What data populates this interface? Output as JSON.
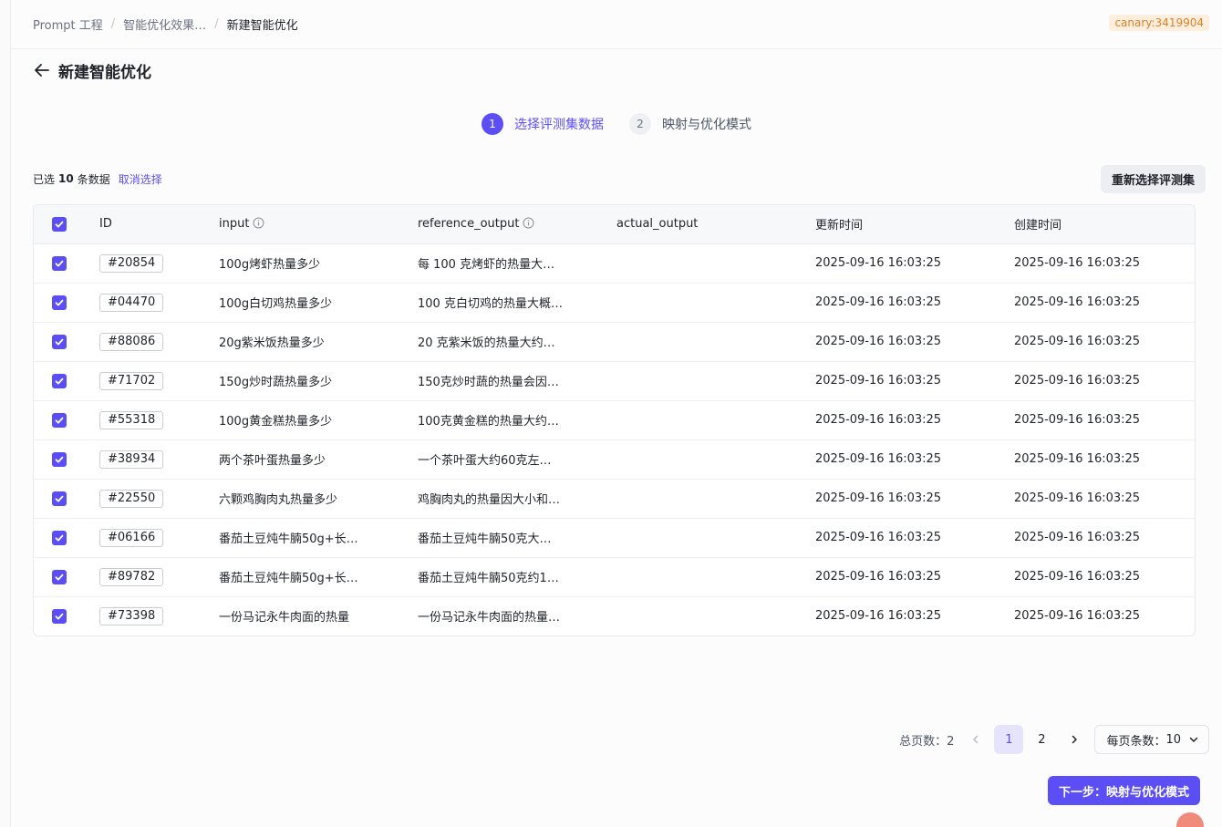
{
  "breadcrumb": {
    "items": [
      "Prompt 工程",
      "智能优化效果…",
      "新建智能优化"
    ],
    "separator": "/"
  },
  "env_badge": "canary:3419904",
  "page": {
    "title": "新建智能优化"
  },
  "steps": [
    {
      "number": "1",
      "label": "选择评测集数据",
      "state": "active"
    },
    {
      "number": "2",
      "label": "映射与优化模式",
      "state": "pending"
    }
  ],
  "selection": {
    "prefix": "已选",
    "count": "10",
    "suffix": "条数据",
    "cancel_label": "取消选择",
    "reselect_label": "重新选择评测集"
  },
  "table": {
    "columns": [
      "ID",
      "input",
      "reference_output",
      "actual_output",
      "更新时间",
      "创建时间"
    ],
    "rows": [
      {
        "id": "#20854",
        "input": "100g烤虾热量多少",
        "reference_output": "每 100 克烤虾的热量大…",
        "actual_output": "",
        "updated": "2025-09-16 16:03:25",
        "created": "2025-09-16 16:03:25"
      },
      {
        "id": "#04470",
        "input": "100g白切鸡热量多少",
        "reference_output": "100 克白切鸡的热量大概…",
        "actual_output": "",
        "updated": "2025-09-16 16:03:25",
        "created": "2025-09-16 16:03:25"
      },
      {
        "id": "#88086",
        "input": "20g紫米饭热量多少",
        "reference_output": "20 克紫米饭的热量大约…",
        "actual_output": "",
        "updated": "2025-09-16 16:03:25",
        "created": "2025-09-16 16:03:25"
      },
      {
        "id": "#71702",
        "input": "150g炒时蔬热量多少",
        "reference_output": "150克炒时蔬的热量会因…",
        "actual_output": "",
        "updated": "2025-09-16 16:03:25",
        "created": "2025-09-16 16:03:25"
      },
      {
        "id": "#55318",
        "input": "100g黄金糕热量多少",
        "reference_output": "100克黄金糕的热量大约…",
        "actual_output": "",
        "updated": "2025-09-16 16:03:25",
        "created": "2025-09-16 16:03:25"
      },
      {
        "id": "#38934",
        "input": "两个茶叶蛋热量多少",
        "reference_output": "一个茶叶蛋大约60克左…",
        "actual_output": "",
        "updated": "2025-09-16 16:03:25",
        "created": "2025-09-16 16:03:25"
      },
      {
        "id": "#22550",
        "input": "六颗鸡胸肉丸热量多少",
        "reference_output": "鸡胸肉丸的热量因大小和…",
        "actual_output": "",
        "updated": "2025-09-16 16:03:25",
        "created": "2025-09-16 16:03:25"
      },
      {
        "id": "#06166",
        "input": "番茄土豆炖牛腩50g+长…",
        "reference_output": "番茄土豆炖牛腩50克大…",
        "actual_output": "",
        "updated": "2025-09-16 16:03:25",
        "created": "2025-09-16 16:03:25"
      },
      {
        "id": "#89782",
        "input": "番茄土豆炖牛腩50g+长…",
        "reference_output": "番茄土豆炖牛腩50克约1…",
        "actual_output": "",
        "updated": "2025-09-16 16:03:25",
        "created": "2025-09-16 16:03:25"
      },
      {
        "id": "#73398",
        "input": "一份马记永牛肉面的热量",
        "reference_output": "一份马记永牛肉面的热量…",
        "actual_output": "",
        "updated": "2025-09-16 16:03:25",
        "created": "2025-09-16 16:03:25"
      }
    ]
  },
  "pagination": {
    "total_label": "总页数：",
    "total_pages": "2",
    "pages": [
      "1",
      "2"
    ],
    "current": "1",
    "page_size_label": "每页条数：",
    "page_size": "10"
  },
  "footer": {
    "next_label": "下一步：映射与优化模式"
  },
  "colors": {
    "accent": "#5b4ef4",
    "badge_bg": "#fdeedd",
    "badge_text": "#d9822b"
  }
}
